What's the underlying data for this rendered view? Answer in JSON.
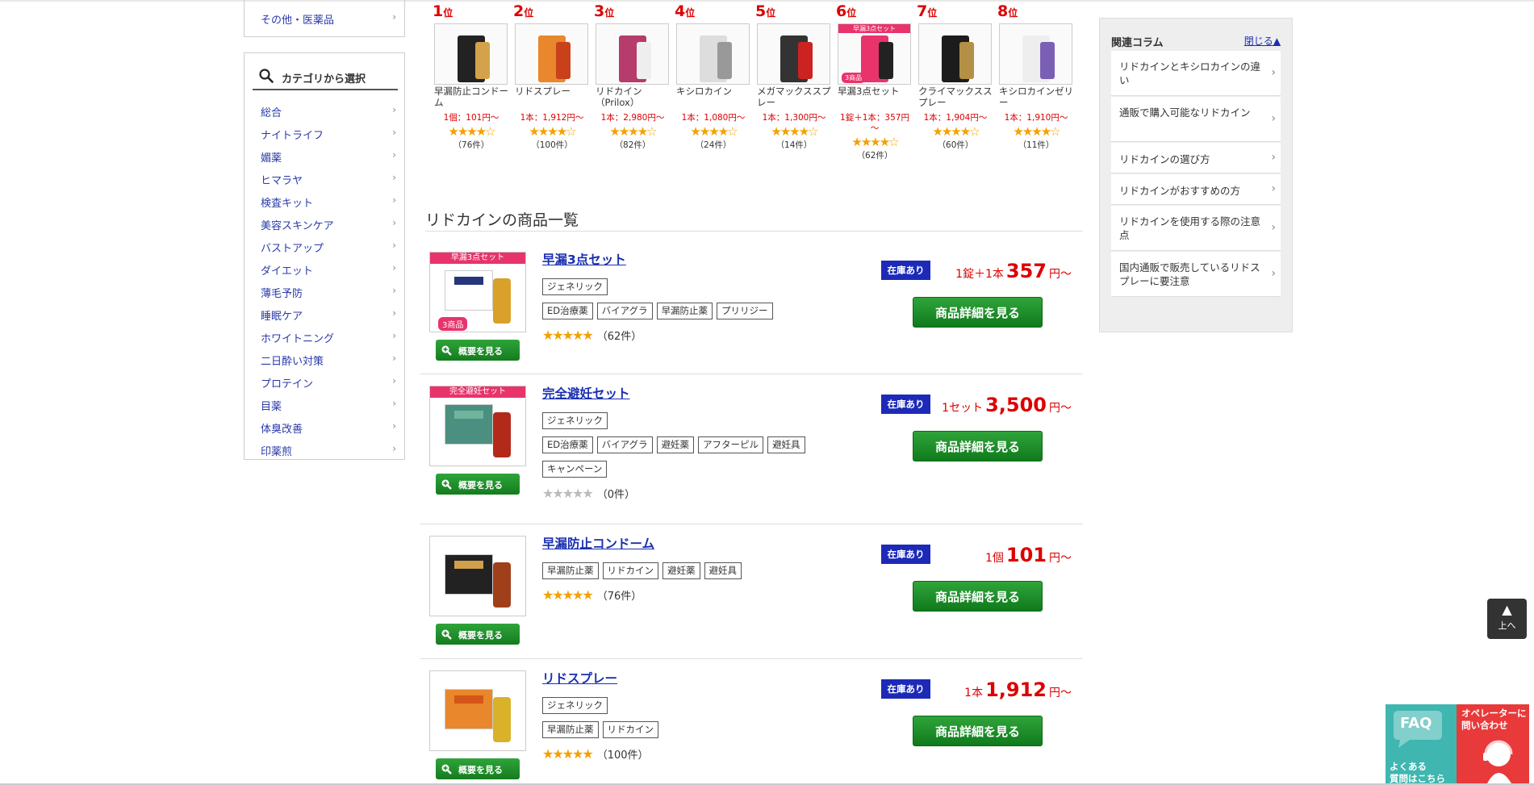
{
  "sidebar": {
    "top_item": "その他・医薬品",
    "category_header": "カテゴリから選択",
    "categories": [
      "総合",
      "ナイトライフ",
      "媚薬",
      "ヒマラヤ",
      "検査キット",
      "美容スキンケア",
      "バストアップ",
      "ダイエット",
      "薄毛予防",
      "睡眠ケア",
      "ホワイトニング",
      "二日酔い対策",
      "プロテイン",
      "目薬",
      "体臭改善",
      "印薬煎"
    ]
  },
  "ranking": [
    {
      "num": "1",
      "pos": "位",
      "name": "早漏防止コンドーム",
      "price": "1個：101円～",
      "count": "（76件）"
    },
    {
      "num": "2",
      "pos": "位",
      "name": "リドスプレー",
      "price": "1本：1,912円～",
      "count": "（100件）"
    },
    {
      "num": "3",
      "pos": "位",
      "name": "リドカイン（Prilox）",
      "price": "1本：2,980円～",
      "count": "（82件）"
    },
    {
      "num": "4",
      "pos": "位",
      "name": "キシロカイン",
      "price": "1本：1,080円～",
      "count": "（24件）"
    },
    {
      "num": "5",
      "pos": "位",
      "name": "メガマックススプレー",
      "price": "1本：1,300円～",
      "count": "（14件）"
    },
    {
      "num": "6",
      "pos": "位",
      "name": "早漏3点セット",
      "price": "1錠＋1本：357円～",
      "count": "（62件）",
      "banner": "早漏3点セット",
      "badge": "3商品"
    },
    {
      "num": "7",
      "pos": "位",
      "name": "クライマックススプレー",
      "price": "1本：1,904円～",
      "count": "（60件）"
    },
    {
      "num": "8",
      "pos": "位",
      "name": "キシロカインゼリー",
      "price": "1本：1,910円～",
      "count": "（11件）"
    }
  ],
  "section_title": "リドカインの商品一覧",
  "products": [
    {
      "title": "早漏3点セット",
      "banner": "早漏3点セット",
      "badge": "3商品",
      "tags_row1": [
        "ジェネリック"
      ],
      "tags_row2": [
        "ED治療薬",
        "バイアグラ",
        "早漏防止薬",
        "プリリジー"
      ],
      "rating": "（62件）",
      "stock": "在庫あり",
      "price_unit": "1錠＋1本",
      "price": "357",
      "price_suffix": "円～",
      "detail": "商品詳細を見る",
      "overview": "概要を見る"
    },
    {
      "title": "完全避妊セット",
      "banner": "完全避妊セット",
      "tags_row1": [
        "ジェネリック"
      ],
      "tags_row2": [
        "ED治療薬",
        "バイアグラ",
        "避妊薬",
        "アフターピル",
        "避妊具"
      ],
      "tags_row3": [
        "キャンペーン"
      ],
      "rating": "（0件）",
      "stock": "在庫あり",
      "price_unit": "1セット",
      "price": "3,500",
      "price_suffix": "円～",
      "detail": "商品詳細を見る",
      "overview": "概要を見る"
    },
    {
      "title": "早漏防止コンドーム",
      "tags_row1": [
        "早漏防止薬",
        "リドカイン",
        "避妊薬",
        "避妊具"
      ],
      "rating": "（76件）",
      "stock": "在庫あり",
      "price_unit": "1個",
      "price": "101",
      "price_suffix": "円～",
      "detail": "商品詳細を見る",
      "overview": "概要を見る"
    },
    {
      "title": "リドスプレー",
      "tags_row1": [
        "ジェネリック"
      ],
      "tags_row2": [
        "早漏防止薬",
        "リドカイン"
      ],
      "rating": "（100件）",
      "stock": "在庫あり",
      "price_unit": "1本",
      "price": "1,912",
      "price_suffix": "円～",
      "detail": "商品詳細を見る",
      "overview": "概要を見る"
    }
  ],
  "column": {
    "header": "関連コラム",
    "close": "閉じる▲",
    "items": [
      "リドカインとキシロカインの違い",
      "通販で購入可能なリドカイン",
      "リドカインの選び方",
      "リドカインがおすすめの方",
      "リドカインを使用する際の注意点",
      "国内通販で販売しているリドスプレーに要注意"
    ]
  },
  "to_top": {
    "arrow": "▲",
    "label": "上へ"
  },
  "faq": {
    "big": "FAQ",
    "line1": "よくある",
    "line2": "質問はこちら"
  },
  "operator": {
    "line1": "オペレーターに",
    "line2": "問い合わせ"
  },
  "icons": {
    "chevron": "chevron-right-icon",
    "search": "search-icon",
    "zoom": "zoom-in-icon",
    "star": "star-icon"
  },
  "colors": {
    "link": "#2a3aa8",
    "price": "#dd0000",
    "stock": "#1d2ab8",
    "button": "#1a8c27",
    "star": "#f5a000"
  }
}
